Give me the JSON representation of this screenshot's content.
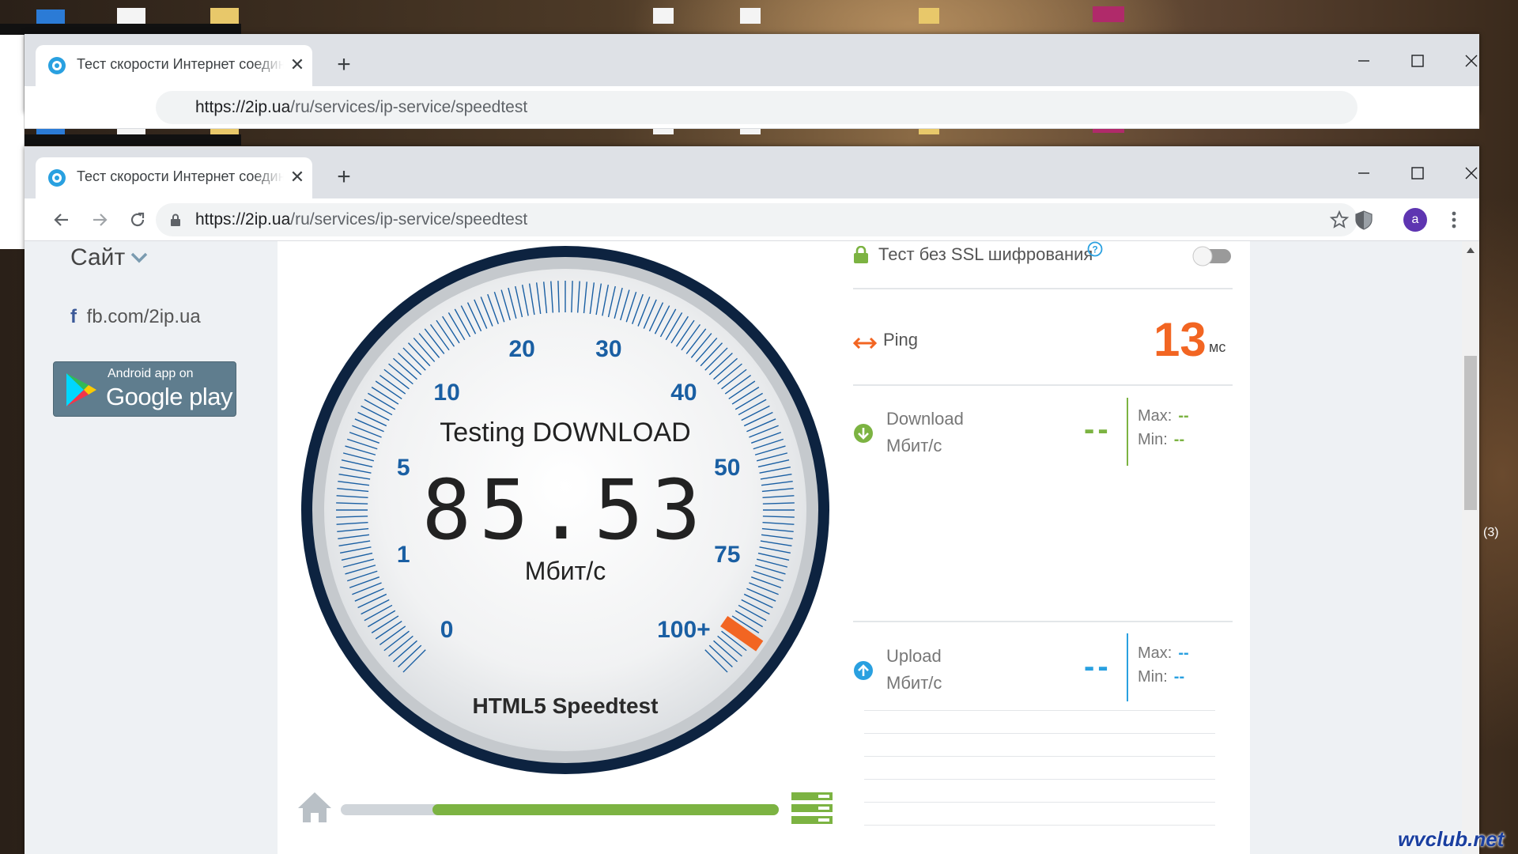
{
  "browser": {
    "tab_title": "Тест скорости Интернет соединения",
    "new_tab": "+",
    "close_tab": "✕",
    "url_host": "https://2ip.ua",
    "url_path": "/ru/services/ip-service/speedtest",
    "avatar_letter": "a"
  },
  "sidebar": {
    "site_label": "Сайт",
    "fb_icon": "f",
    "fb_label": "fb.com/2ip.ua",
    "gp_small": "Android app on",
    "gp_big": "Google play"
  },
  "gauge": {
    "status": "Testing DOWNLOAD",
    "value": "85.53",
    "unit": "Мбит/с",
    "brand": "HTML5 Speedtest",
    "ticks": [
      "0",
      "1",
      "5",
      "10",
      "20",
      "30",
      "40",
      "50",
      "75",
      "100+"
    ]
  },
  "progress": {
    "fraction": 0.79,
    "fill_start": 0.21
  },
  "right": {
    "ssl_label": "Тест без SSL шифрования",
    "ssl_enabled": false,
    "ping_label": "Ping",
    "ping_value": "13",
    "ping_unit": "мс",
    "download_label": "Download",
    "download_unit": "Мбит/с",
    "download_value": "--",
    "download_max_label": "Max:",
    "download_max": "--",
    "download_min_label": "Min:",
    "download_min": "--",
    "upload_label": "Upload",
    "upload_unit": "Мбит/с",
    "upload_value": "--",
    "upload_max_label": "Max:",
    "upload_max": "--",
    "upload_min_label": "Min:",
    "upload_min": "--"
  },
  "desktop": {
    "watermark": "wvclub.net",
    "side_text": "(3)"
  },
  "colors": {
    "accent_orange": "#f26522",
    "accent_green": "#7cb342",
    "accent_blue": "#29a0e0",
    "gauge_ticks": "#1a5fa3",
    "gauge_ring": "#0d2340"
  }
}
